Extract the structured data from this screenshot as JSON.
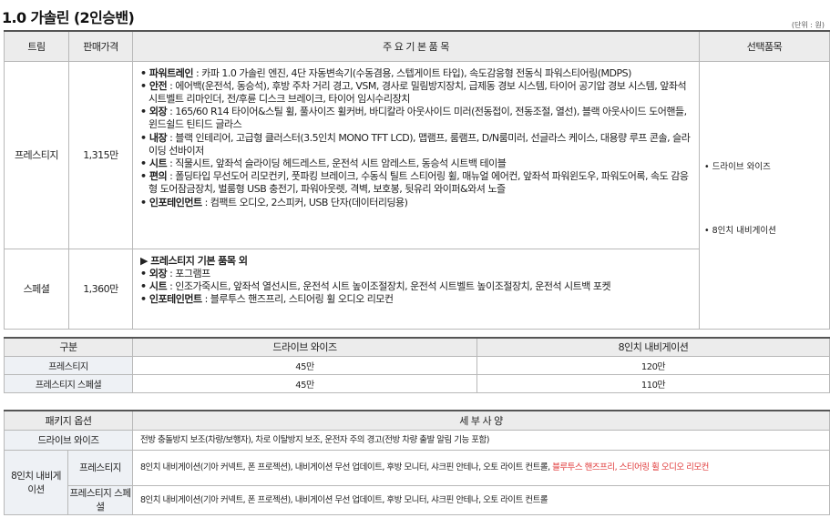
{
  "title": "1.0 가솔린 (2인승밴)",
  "unit": "(단위 : 원)",
  "headers": {
    "trim": "트림",
    "price": "판매가격",
    "items": "주 요 기 본 품 목",
    "options": "선택품목"
  },
  "trims": [
    {
      "name": "프레스티지",
      "price": "1,315만",
      "items": [
        {
          "label": "• 파워트레인",
          "text": " : 카파 1.0 가솔린 엔진, 4단 자동변속기(수동겸용, 스텝게이트 타입), 속도감응형 전동식 파워스티어링(MDPS)"
        },
        {
          "label": "• 안전",
          "text": " : 에어백(운전석, 동승석), 후방 주차 거리 경고, VSM, 경사로 밀림방지장치, 급제동 경보 시스템, 타이어 공기압 경보 시스템, 앞좌석 시트벨트 리마인더, 전/후륜 디스크 브레이크, 타이어 임시수리장치"
        },
        {
          "label": "• 외장",
          "text": " : 165/60 R14 타이어&스틸 휠, 풀사이즈 휠커버, 바디칼라 아웃사이드 미러(전동접이, 전동조절, 열선), 블랙 아웃사이드 도어핸들, 윈드쉴드 틴티드 글라스"
        },
        {
          "label": "• 내장",
          "text": " : 블랙 인테리어, 고급형 클러스터(3.5인치 MONO TFT LCD), 맵램프, 룸램프, D/N룸미러, 선글라스 케이스, 대용량 루프 콘솔, 슬라이딩 선바이저"
        },
        {
          "label": "• 시트",
          "text": " : 직물시트, 앞좌석 슬라이딩 헤드레스트, 운전석 시트 암레스트, 동승석 시트백 테이블"
        },
        {
          "label": "• 편의",
          "text": " : 폴딩타입 무선도어 리모컨키, 풋파킹 브레이크, 수동식 틸트 스티어링 휠, 매뉴얼 에어컨, 앞좌석 파워윈도우, 파워도어록, 속도 감응형 도어잠금장치, 벌룸형 USB 충전기, 파워아웃렛, 격벽, 보호봉, 뒷유리 와이퍼&와셔 노즐"
        },
        {
          "label": "• 인포테인먼트",
          "text": " : 컴팩트 오디오, 2스피커, USB 단자(데이터리딩용)"
        }
      ]
    },
    {
      "name": "스페셜",
      "price": "1,360만",
      "heading": "▶ 프레스티지 기본 품목 외",
      "items": [
        {
          "label": "• 외장",
          "text": " : 포그램프"
        },
        {
          "label": "• 시트",
          "text": " : 인조가죽시트, 앞좌석 열선시트, 운전석 시트 높이조절장치, 운전석 시트벨트 높이조절장치, 운전석 시트백 포켓"
        },
        {
          "label": "• 인포테인먼트",
          "text": " : 블루투스 핸즈프리, 스티어링 휠 오디오 리모컨"
        }
      ]
    }
  ],
  "options": [
    "• 드라이브 와이즈",
    "• 8인치 내비게이션"
  ],
  "option_prices": {
    "headers": [
      "구분",
      "드라이브 와이즈",
      "8인치 내비게이션"
    ],
    "rows": [
      {
        "label": "프레스티지",
        "values": [
          "45만",
          "120만"
        ]
      },
      {
        "label": "프레스티지 스페셜",
        "values": [
          "45만",
          "110만"
        ]
      }
    ]
  },
  "packages": {
    "headers": [
      "패키지 옵션",
      "세 부 사 양"
    ],
    "drive_wise": {
      "label": "드라이브 와이즈",
      "desc": "전방 충돌방지 보조(차량/보행자), 차로 이탈방지 보조, 운전자 주의 경고(전방 차량 출발 알림 기능 포함)"
    },
    "navi": {
      "label": "8인치 내비게이션",
      "prestige": {
        "label": "프레스티지",
        "desc": "8인치 내비게이션(기아 커넥트, 폰 프로젝션), 내비게이션 무선 업데이트, 후방 모니터, 샤크핀 안테나, 오토 라이트 컨트롤,",
        "desc_red": " 블루투스 핸즈프리, 스티어링 휠 오디오 리모컨"
      },
      "special": {
        "label": "프레스티지 스페셜",
        "desc": "8인치 내비게이션(기아 커넥트, 폰 프로젝션), 내비게이션 무선 업데이트, 후방 모니터, 샤크핀 안테나, 오토 라이트 컨트롤"
      }
    }
  },
  "colors": {
    "header_bg": "#ececec",
    "label_bg": "#eef1f5",
    "accent_red": "#e03c3c"
  }
}
